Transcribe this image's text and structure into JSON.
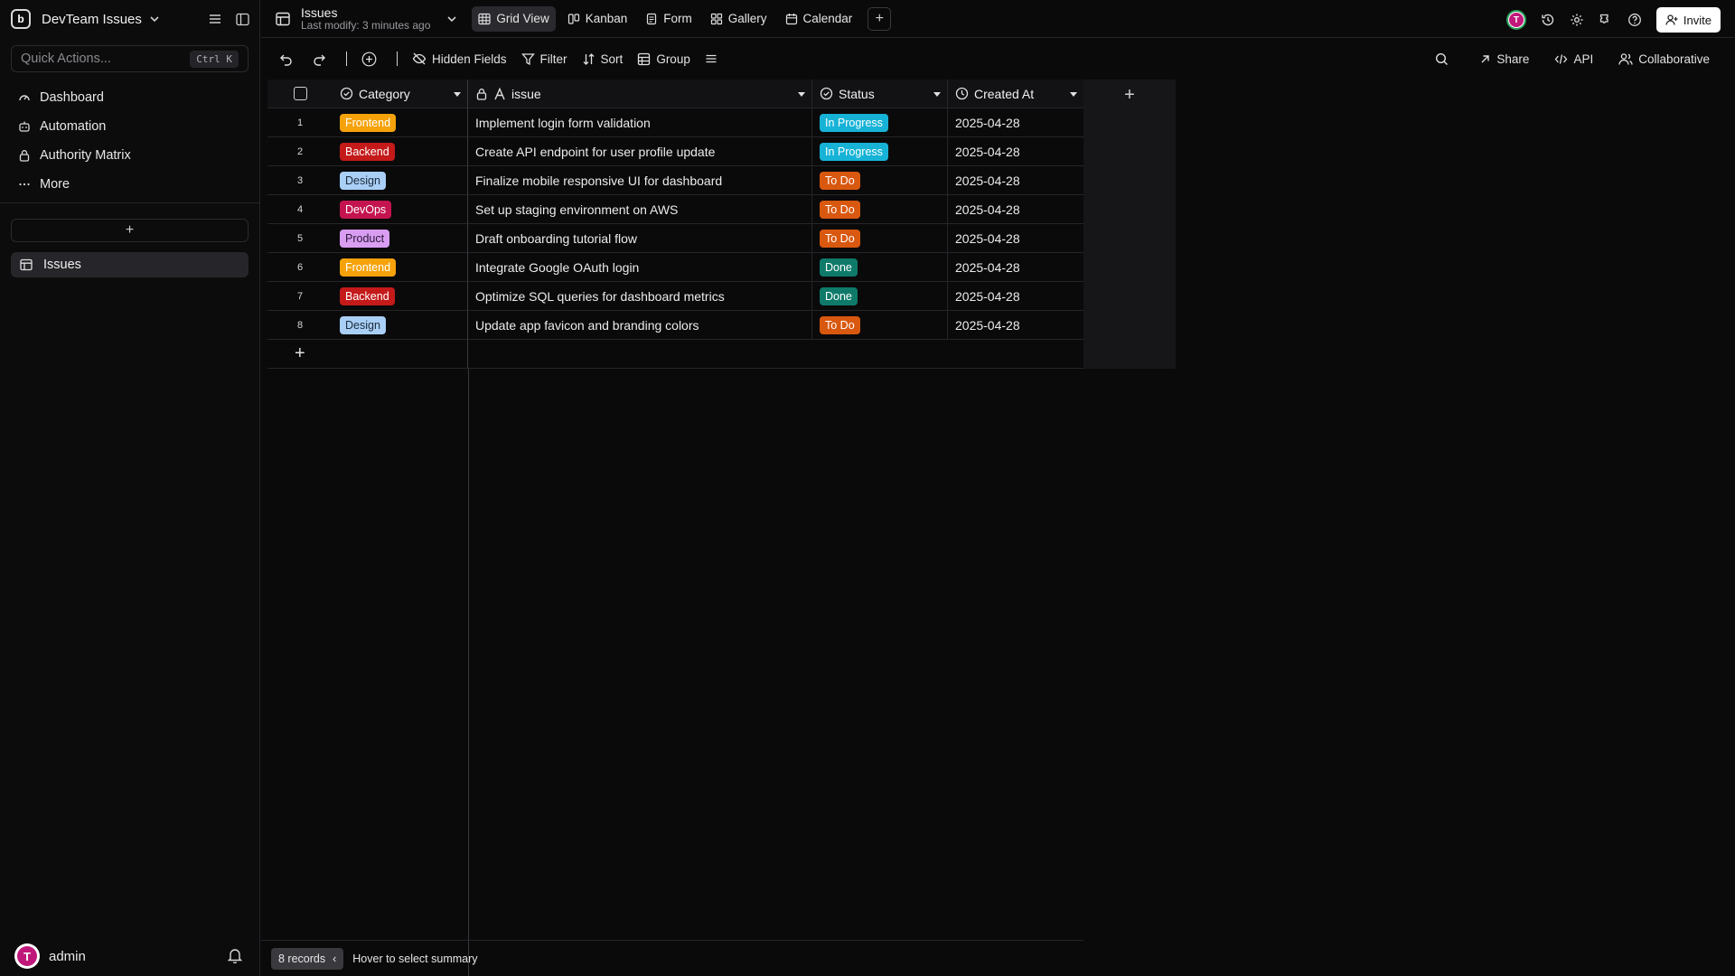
{
  "workspace": {
    "name": "DevTeam Issues"
  },
  "quick_actions": {
    "placeholder": "Quick Actions...",
    "shortcut": "Ctrl K"
  },
  "nav": [
    {
      "label": "Dashboard",
      "icon": "dashboard-icon"
    },
    {
      "label": "Automation",
      "icon": "robot-icon"
    },
    {
      "label": "Authority Matrix",
      "icon": "lock-icon"
    },
    {
      "label": "More",
      "icon": "ellipsis-icon"
    }
  ],
  "add_table_label": "+",
  "tables": [
    {
      "label": "Issues",
      "icon": "table-icon"
    }
  ],
  "user": {
    "name": "admin",
    "initial": "T"
  },
  "header": {
    "table_title": "Issues",
    "last_modify": "Last modify: 3 minutes ago",
    "views": [
      {
        "label": "Grid View",
        "icon": "grid-icon",
        "active": true
      },
      {
        "label": "Kanban",
        "icon": "kanban-icon",
        "active": false
      },
      {
        "label": "Form",
        "icon": "form-icon",
        "active": false
      },
      {
        "label": "Gallery",
        "icon": "gallery-icon",
        "active": false
      },
      {
        "label": "Calendar",
        "icon": "calendar-icon",
        "active": false
      }
    ],
    "add_view_label": "+",
    "invite_label": "Invite"
  },
  "toolbar": {
    "hidden_fields": "Hidden Fields",
    "filter": "Filter",
    "sort": "Sort",
    "group": "Group",
    "share": "Share",
    "api": "API",
    "collaborative": "Collaborative"
  },
  "columns": {
    "category": "Category",
    "issue": "issue",
    "status": "Status",
    "created_at": "Created At"
  },
  "category_colors": {
    "Frontend": {
      "bg": "#f5a20b",
      "fg": "#ffffff"
    },
    "Backend": {
      "bg": "#c41a1a",
      "fg": "#ffffff"
    },
    "Design": {
      "bg": "#a9cff6",
      "fg": "#1c2a3a"
    },
    "DevOps": {
      "bg": "#c4144f",
      "fg": "#ffffff"
    },
    "Product": {
      "bg": "#d99ef2",
      "fg": "#2c1836"
    }
  },
  "status_colors": {
    "In Progress": {
      "bg": "#17b3d6",
      "fg": "#ffffff"
    },
    "To Do": {
      "bg": "#d9580f",
      "fg": "#ffffff"
    },
    "Done": {
      "bg": "#0f7a6a",
      "fg": "#ffffff"
    }
  },
  "rows": [
    {
      "num": "1",
      "category": "Frontend",
      "issue": "Implement login form validation",
      "status": "In Progress",
      "created_at": "2025-04-28"
    },
    {
      "num": "2",
      "category": "Backend",
      "issue": "Create API endpoint for user profile update",
      "status": "In Progress",
      "created_at": "2025-04-28"
    },
    {
      "num": "3",
      "category": "Design",
      "issue": "Finalize mobile responsive UI for dashboard",
      "status": "To Do",
      "created_at": "2025-04-28"
    },
    {
      "num": "4",
      "category": "DevOps",
      "issue": "Set up staging environment on AWS",
      "status": "To Do",
      "created_at": "2025-04-28"
    },
    {
      "num": "5",
      "category": "Product",
      "issue": "Draft onboarding tutorial flow",
      "status": "To Do",
      "created_at": "2025-04-28"
    },
    {
      "num": "6",
      "category": "Frontend",
      "issue": "Integrate Google OAuth login",
      "status": "Done",
      "created_at": "2025-04-28"
    },
    {
      "num": "7",
      "category": "Backend",
      "issue": "Optimize SQL queries for dashboard metrics",
      "status": "Done",
      "created_at": "2025-04-28"
    },
    {
      "num": "8",
      "category": "Design",
      "issue": "Update app favicon and branding colors",
      "status": "To Do",
      "created_at": "2025-04-28"
    }
  ],
  "footer": {
    "records": "8 records",
    "summary_hint": "Hover to select summary"
  }
}
